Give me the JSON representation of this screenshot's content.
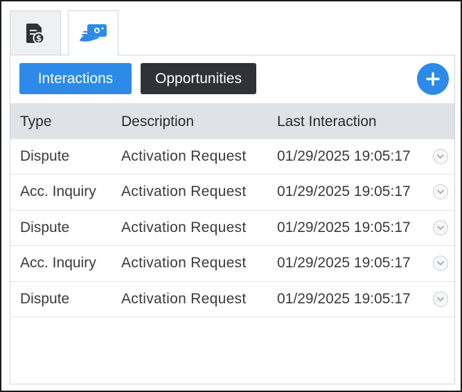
{
  "toolbar": {
    "interactions_label": "Interactions",
    "opportunities_label": "Opportunities"
  },
  "colors": {
    "accent": "#2d8ae8",
    "dark_button": "#2f3236",
    "header_bg": "#dfe3e7"
  },
  "icons": {
    "tab1": "billing-document-icon",
    "tab2": "interaction-handshake-icon",
    "add": "plus-icon",
    "row_action": "chevron-down-icon"
  },
  "table": {
    "headers": {
      "type": "Type",
      "description": "Description",
      "last_interaction": "Last Interaction"
    },
    "rows": [
      {
        "type": "Dispute",
        "description": "Activation Request",
        "last_interaction": "01/29/2025 19:05:17"
      },
      {
        "type": "Acc. Inquiry",
        "description": "Activation Request",
        "last_interaction": "01/29/2025 19:05:17"
      },
      {
        "type": "Dispute",
        "description": "Activation Request",
        "last_interaction": "01/29/2025 19:05:17"
      },
      {
        "type": "Acc. Inquiry",
        "description": "Activation Request",
        "last_interaction": "01/29/2025 19:05:17"
      },
      {
        "type": "Dispute",
        "description": "Activation Request",
        "last_interaction": "01/29/2025 19:05:17"
      }
    ]
  }
}
